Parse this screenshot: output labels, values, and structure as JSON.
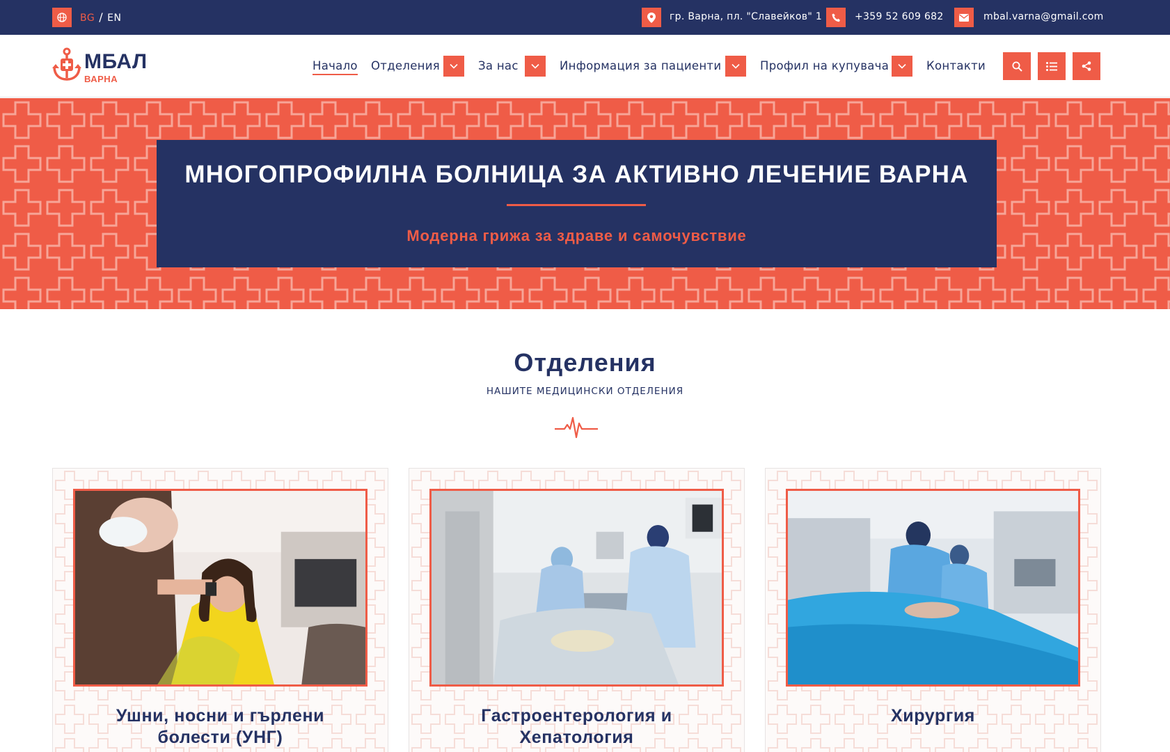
{
  "topbar": {
    "lang_bg": "BG",
    "lang_sep": "/",
    "lang_en": "EN",
    "address": "гр. Варна, пл. \"Славейков\" 1",
    "phone": "+359 52 609 682",
    "email": "mbal.varna@gmail.com"
  },
  "header": {
    "logo_title": "МБАЛ",
    "logo_sub": "ВАРНА",
    "nav": [
      {
        "label": "Начало"
      },
      {
        "label": "Отделения"
      },
      {
        "label": "За нас"
      },
      {
        "label": "Информация за пациенти"
      },
      {
        "label": "Профил на купувача"
      },
      {
        "label": "Контакти"
      }
    ]
  },
  "hero": {
    "title": "МНОГОПРОФИЛНА БОЛНИЦА ЗА АКТИВНО ЛЕЧЕНИЕ ВАРНА",
    "subtitle": "Модерна грижа за здраве и самочувствие"
  },
  "section": {
    "title": "Отделения",
    "subtitle": "НАШИТЕ МЕДИЦИНСКИ ОТДЕЛЕНИЯ"
  },
  "cards": [
    {
      "title": "Ушни, носни и гърлени болести (УНГ)"
    },
    {
      "title": "Гастроентерология и Хепатология"
    },
    {
      "title": "Хирургия"
    }
  ],
  "colors": {
    "navy": "#253263",
    "accent": "#ef5c47",
    "white": "#ffffff"
  },
  "icons": {
    "lang": "globe-icon",
    "address": "location-pin-icon",
    "phone": "phone-icon",
    "email": "envelope-icon",
    "search": "search-icon",
    "menu": "list-icon",
    "share": "share-icon",
    "dropdown": "chevron-down-icon",
    "divider": "heartbeat-icon"
  }
}
